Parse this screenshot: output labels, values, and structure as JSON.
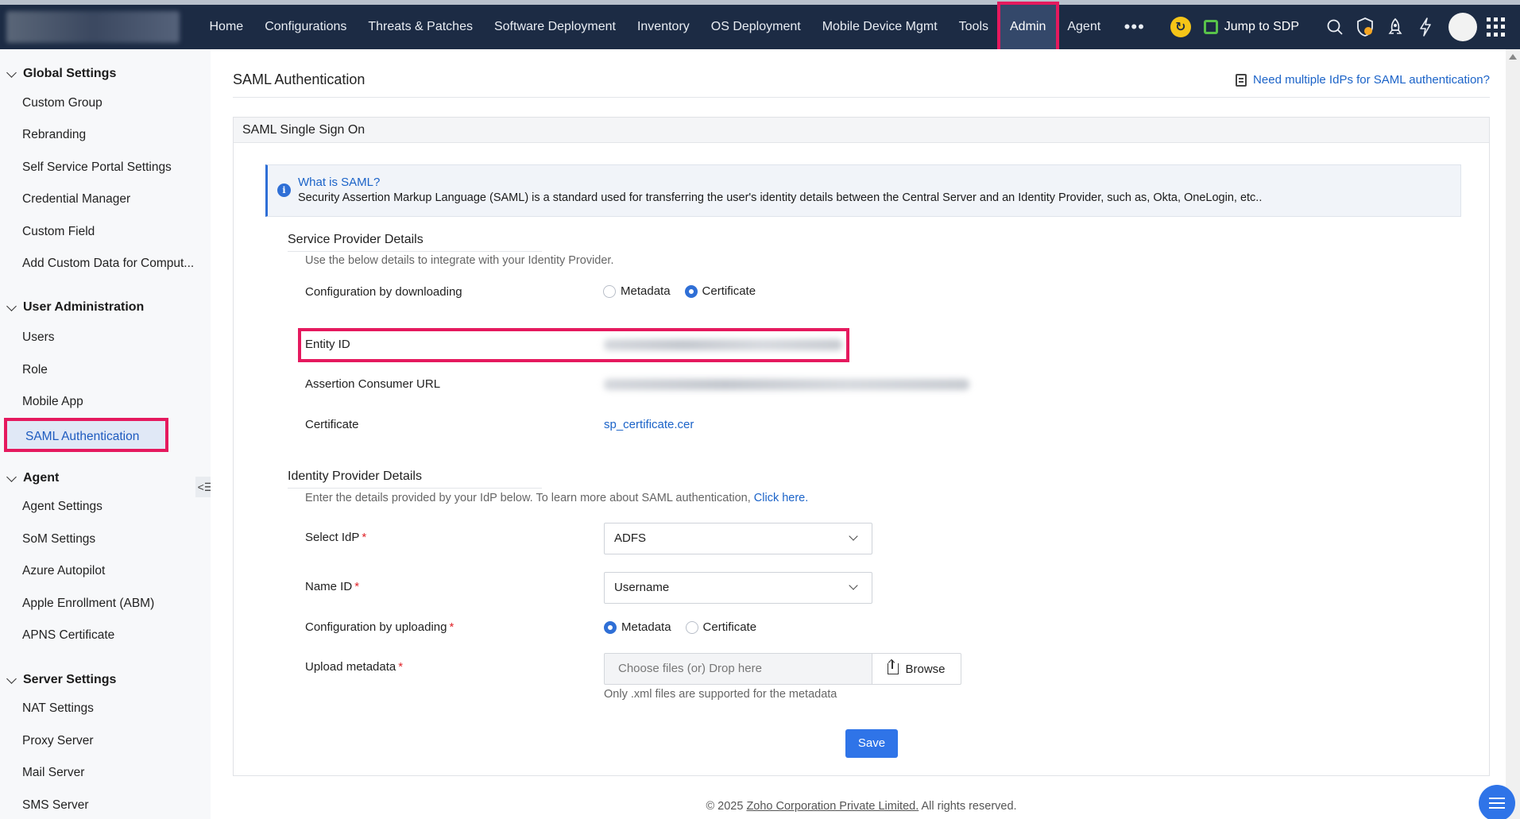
{
  "topbar": {
    "nav": [
      "Home",
      "Configurations",
      "Threats & Patches",
      "Software Deployment",
      "Inventory",
      "OS Deployment",
      "Mobile Device Mgmt",
      "Tools",
      "Admin",
      "Agent"
    ],
    "more": "•••",
    "active": "Admin",
    "jump_sdp": "Jump to SDP"
  },
  "sidebar": {
    "sections": [
      {
        "title": "Global Settings",
        "items": [
          "Custom Group",
          "Rebranding",
          "Self Service Portal Settings",
          "Credential Manager",
          "Custom Field",
          "Add Custom Data for Comput..."
        ]
      },
      {
        "title": "User Administration",
        "items": [
          "Users",
          "Role",
          "Mobile App",
          "SAML Authentication"
        ]
      },
      {
        "title": "Agent",
        "items": [
          "Agent Settings",
          "SoM Settings",
          "Azure Autopilot",
          "Apple Enrollment (ABM)",
          "APNS Certificate"
        ]
      },
      {
        "title": "Server Settings",
        "items": [
          "NAT Settings",
          "Proxy Server",
          "Mail Server",
          "SMS Server"
        ]
      }
    ],
    "active_item": "SAML Authentication"
  },
  "main": {
    "title": "SAML Authentication",
    "multi_idp_link": "Need multiple IdPs for SAML authentication?",
    "panel_title": "SAML Single Sign On",
    "info": {
      "title": "What is SAML?",
      "text": "Security Assertion Markup Language (SAML) is a standard used for transferring the user's identity details between the Central Server and an Identity Provider, such as, Okta, OneLogin, etc.."
    },
    "sp": {
      "title": "Service Provider Details",
      "help": "Use the below details to integrate with your Identity Provider.",
      "config_label": "Configuration by downloading",
      "config_options": [
        "Metadata",
        "Certificate"
      ],
      "config_selected": "Certificate",
      "entity_id_label": "Entity ID",
      "acs_label": "Assertion Consumer URL",
      "certificate_label": "Certificate",
      "certificate_file": "sp_certificate.cer"
    },
    "idp": {
      "title": "Identity Provider Details",
      "help": "Enter the details provided by your IdP below. To learn more about SAML authentication,",
      "help_link": "Click here.",
      "select_idp_label": "Select IdP",
      "select_idp_value": "ADFS",
      "name_id_label": "Name ID",
      "name_id_value": "Username",
      "upload_config_label": "Configuration by uploading",
      "upload_options": [
        "Metadata",
        "Certificate"
      ],
      "upload_selected": "Metadata",
      "upload_metadata_label": "Upload metadata",
      "file_placeholder": "Choose files (or) Drop here",
      "browse_label": "Browse",
      "file_hint": "Only .xml files are supported for the metadata",
      "save_label": "Save"
    }
  },
  "footer": {
    "prefix": "© 2025 ",
    "company": "Zoho Corporation Private Limited.",
    "suffix": " All rights reserved."
  },
  "colors": {
    "nav_bg": "#1c2b44",
    "highlight": "#e5195e",
    "accent": "#2f74e8"
  }
}
